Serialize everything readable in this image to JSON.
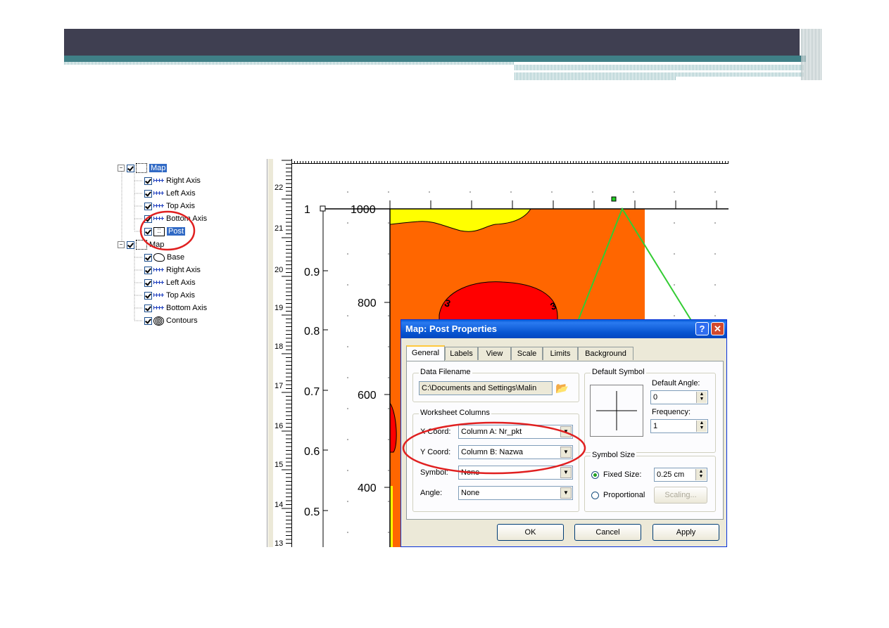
{
  "tree": {
    "items": [
      {
        "label": "Map",
        "icon": "map-icon",
        "kind": "map",
        "selected": true
      },
      {
        "label": "Right Axis",
        "icon": "axis-icon"
      },
      {
        "label": "Left Axis",
        "icon": "axis-icon"
      },
      {
        "label": "Top Axis",
        "icon": "axis-icon"
      },
      {
        "label": "Bottom Axis",
        "icon": "axis-icon"
      },
      {
        "label": "Post",
        "icon": "post-icon",
        "selected": true
      },
      {
        "label": "Map",
        "icon": "map-icon",
        "kind": "map"
      },
      {
        "label": "Base",
        "icon": "base-icon"
      },
      {
        "label": "Right Axis",
        "icon": "axis-icon"
      },
      {
        "label": "Left Axis",
        "icon": "axis-icon"
      },
      {
        "label": "Top Axis",
        "icon": "axis-icon"
      },
      {
        "label": "Bottom Axis",
        "icon": "axis-icon"
      },
      {
        "label": "Contours",
        "icon": "contours-icon"
      }
    ]
  },
  "ruler": {
    "labels": [
      "22",
      "21",
      "20",
      "19",
      "18",
      "17",
      "16",
      "15",
      "14",
      "13"
    ]
  },
  "plot": {
    "left_axis": {
      "labels": [
        "1",
        "0.9",
        "0.8",
        "0.7",
        "0.6",
        "0.5"
      ]
    },
    "map_axis": {
      "labels": [
        "1000",
        "800",
        "600",
        "400"
      ]
    },
    "contour_labels": [
      "3",
      "3"
    ],
    "colors": {
      "yellow": "#ffff00",
      "orange": "#ff6600",
      "red": "#ff0000",
      "green_line": "#33cc33"
    }
  },
  "dialog": {
    "title": "Map: Post Properties",
    "help_btn": "?",
    "close_btn": "✕",
    "tabs": [
      "General",
      "Labels",
      "View",
      "Scale",
      "Limits",
      "Background"
    ],
    "data_filename": {
      "group": "Data Filename",
      "value": "C:\\Documents and Settings\\Malin"
    },
    "worksheet": {
      "group": "Worksheet Columns",
      "x_label": "X Coord:",
      "x_value": "Column A:  Nr_pkt",
      "y_label": "Y Coord:",
      "y_value": "Column B:  Nazwa",
      "symbol_label": "Symbol:",
      "symbol_value": "None",
      "angle_label": "Angle:",
      "angle_value": "None"
    },
    "default_symbol": {
      "group": "Default Symbol",
      "angle_label": "Default Angle:",
      "angle_value": "0",
      "freq_label": "Frequency:",
      "freq_value": "1"
    },
    "symbol_size": {
      "group": "Symbol Size",
      "fixed_label": "Fixed Size:",
      "fixed_value": "0.25 cm",
      "proportional_label": "Proportional",
      "scaling_btn": "Scaling..."
    },
    "buttons": {
      "ok": "OK",
      "cancel": "Cancel",
      "apply": "Apply"
    }
  },
  "annotations": {
    "circle_color": "#e02020"
  }
}
